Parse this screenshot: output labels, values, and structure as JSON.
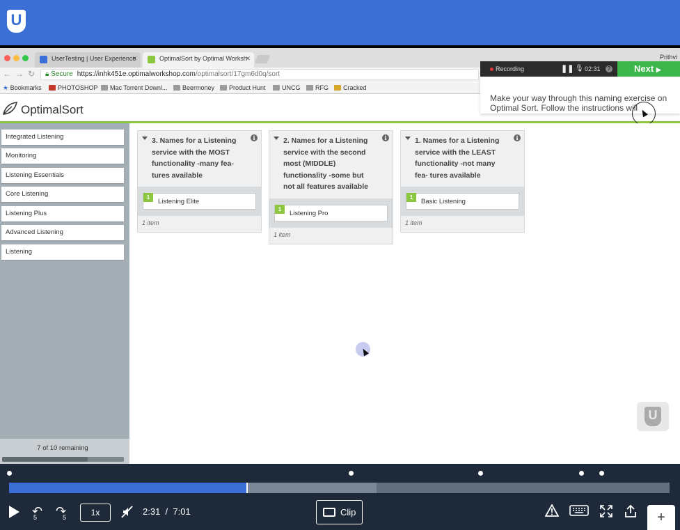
{
  "app": {
    "logo_letter": "U"
  },
  "browser": {
    "tabs": [
      {
        "label": "UserTesting | User Experience",
        "favicon_color": "#3b6fd6"
      },
      {
        "label": "OptimalSort by Optimal Worksh",
        "favicon_color": "#8dc63f"
      }
    ],
    "user": "Prithvi",
    "url_secure": "Secure",
    "url_host": "https://inhk451e.optimalworkshop.com",
    "url_path": "/optimalsort/17gm6d0q/sort",
    "bookmarks": [
      "Bookmarks",
      "PHOTOSHOP",
      "Mac Torrent Downl...",
      "Beermoney",
      "Product Hunt",
      "UNCG",
      "RFG",
      "Cracked"
    ]
  },
  "recorder": {
    "status": "Recording",
    "elapsed": "02:31",
    "next_label": "Next",
    "instruction": "Make your way through this naming exercise on Optimal Sort. Follow the instructions will"
  },
  "optimalsort": {
    "title": "OptimalSort",
    "cards": [
      "Integrated Listening",
      "Monitoring",
      "Listening Essentials",
      "Core Listening",
      "Listening Plus",
      "Advanced Listening",
      "Listening"
    ],
    "remaining": "7 of 10 remaining",
    "progress_fraction": 0.7,
    "groups": [
      {
        "title": "3. Names for a Listening service with the MOST functionality -many fea- tures available",
        "items": [
          {
            "num": "1",
            "label": "Listening Elite"
          }
        ],
        "count": "1 item"
      },
      {
        "title": "2. Names for a Listening service with the second most (MIDDLE) functionality -some but not all features available",
        "items": [
          {
            "num": "1",
            "label": "Listening Pro"
          }
        ],
        "count": "1 item"
      },
      {
        "title": "1. Names for a Listening service with the LEAST functionality -not many fea- tures available",
        "items": [
          {
            "num": "1",
            "label": "Basic Listening"
          }
        ],
        "count": "1 item"
      }
    ]
  },
  "player": {
    "current": "2:31",
    "separator": "/",
    "total": "7:01",
    "played_fraction": 0.36,
    "buffered_fraction": 0.556,
    "speed": "1x",
    "skip_back": "5",
    "skip_forward": "5",
    "clip_label": "Clip",
    "marker_fractions": [
      0.0,
      0.518,
      0.714,
      0.867,
      0.897
    ]
  },
  "colors": {
    "brand_blue": "#3b6fd6",
    "accent_green": "#8dc63f",
    "next_green": "#3cb54a"
  }
}
